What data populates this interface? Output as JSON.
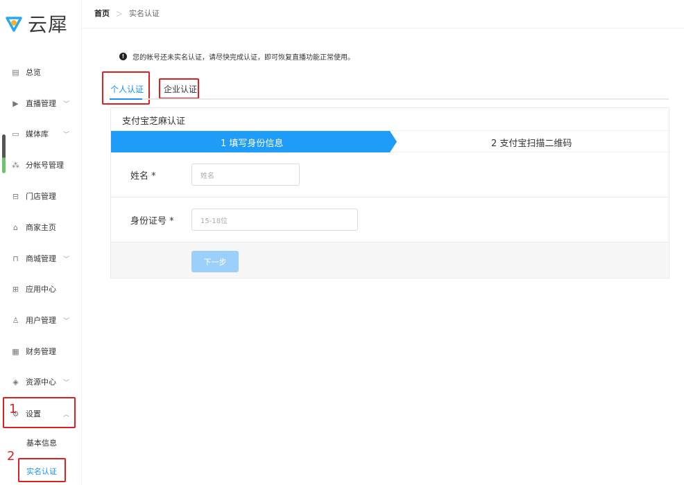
{
  "brand": {
    "logo_text": "云犀",
    "logo_color_primary": "#27a8f0",
    "logo_color_secondary": "#f7b32b"
  },
  "sidebar": {
    "items": [
      {
        "label": "总览",
        "icon": "chart-icon",
        "has_chevron": false
      },
      {
        "label": "直播管理",
        "icon": "play-icon",
        "has_chevron": true
      },
      {
        "label": "媒体库",
        "icon": "folder-icon",
        "has_chevron": true
      },
      {
        "label": "分帐号管理",
        "icon": "org-icon",
        "has_chevron": false
      },
      {
        "label": "门店管理",
        "icon": "store-icon",
        "has_chevron": false
      },
      {
        "label": "商家主页",
        "icon": "home-icon",
        "has_chevron": false
      },
      {
        "label": "商城管理",
        "icon": "bag-icon",
        "has_chevron": true
      },
      {
        "label": "应用中心",
        "icon": "apps-icon",
        "has_chevron": false
      },
      {
        "label": "用户管理",
        "icon": "user-icon",
        "has_chevron": true
      },
      {
        "label": "财务管理",
        "icon": "finance-icon",
        "has_chevron": false
      },
      {
        "label": "资源中心",
        "icon": "layers-icon",
        "has_chevron": true
      },
      {
        "label": "设置",
        "icon": "settings-icon",
        "has_chevron": true,
        "expanded": true
      }
    ],
    "sub_items": [
      {
        "label": "基本信息",
        "active": false
      },
      {
        "label": "实名认证",
        "active": true
      }
    ]
  },
  "breadcrumb": {
    "home": "首页",
    "current": "实名认证"
  },
  "notice": {
    "text": "您的帐号还未实名认证，请尽快完成认证，即可恢复直播功能正常使用。"
  },
  "tabs": [
    {
      "label": "个人认证",
      "active": true
    },
    {
      "label": "企业认证",
      "active": false
    }
  ],
  "panel": {
    "title": "支付宝芝麻认证",
    "steps": [
      {
        "label": "1 填写身份信息",
        "active": true
      },
      {
        "label": "2 支付宝扫描二维码",
        "active": false
      }
    ],
    "fields": [
      {
        "label": "姓名 *",
        "placeholder": "姓名"
      },
      {
        "label": "身份证号 *",
        "placeholder": "15-18位"
      }
    ],
    "next_button": "下一步"
  },
  "annotations": {
    "marker_1": "1",
    "marker_2": "2",
    "color": "#e02020"
  },
  "colors": {
    "accent": "#1890ff",
    "step_active": "#1f9cf8",
    "button_disabled": "#9bd0fb"
  }
}
